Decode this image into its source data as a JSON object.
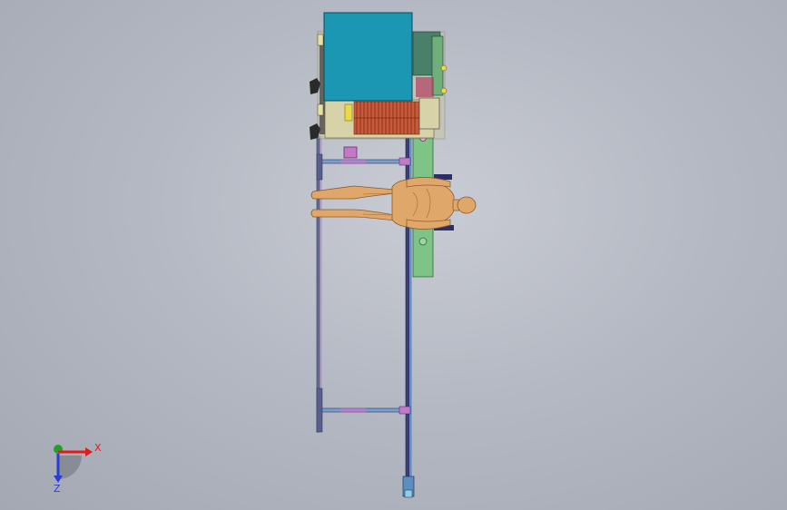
{
  "colors": {
    "background": "#b8bcc5",
    "cabinet": "#1b96b3",
    "frame": "#2a2f6a",
    "base_plate": "#7fc487",
    "coils": "#c85a3a",
    "figure": "#e0a76a",
    "block_magenta": "#c478c8",
    "axis_x": "#e11b1b",
    "axis_y": "#22a02a",
    "axis_z": "#2a3bd6"
  },
  "triad": {
    "x_label": "X",
    "z_label": "Z"
  }
}
